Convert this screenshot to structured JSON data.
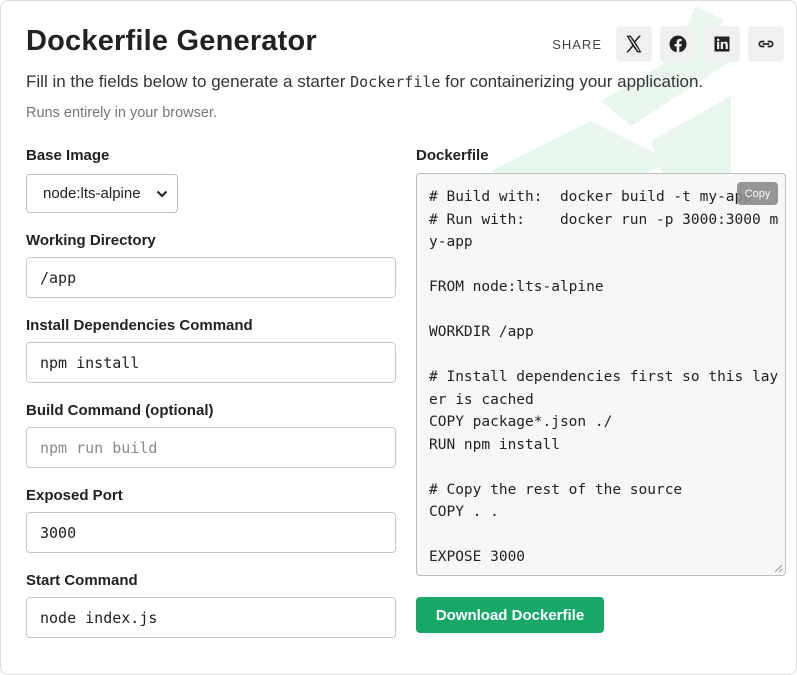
{
  "header": {
    "title": "Dockerfile Generator",
    "intro_before": "Fill in the fields below to generate a starter ",
    "intro_code": "Dockerfile",
    "intro_after": " for containerizing your application.",
    "subnote": "Runs entirely in your browser."
  },
  "share": {
    "label": "SHARE",
    "icons": [
      "x-icon",
      "facebook-icon",
      "linkedin-icon",
      "link-icon"
    ]
  },
  "form": {
    "base_image": {
      "label": "Base Image",
      "value": "node:lts-alpine"
    },
    "working_directory": {
      "label": "Working Directory",
      "value": "/app"
    },
    "install_command": {
      "label": "Install Dependencies Command",
      "value": "npm install"
    },
    "build_command": {
      "label": "Build Command (optional)",
      "value": "",
      "placeholder": "npm run build"
    },
    "exposed_port": {
      "label": "Exposed Port",
      "value": "3000"
    },
    "start_command": {
      "label": "Start Command",
      "value": "node index.js"
    }
  },
  "output": {
    "label": "Dockerfile",
    "copy_label": "Copy",
    "content": "# Build with:  docker build -t my-app .\n# Run with:    docker run -p 3000:3000 my-app\n\nFROM node:lts-alpine\n\nWORKDIR /app\n\n# Install dependencies first so this layer is cached\nCOPY package*.json ./\nRUN npm install\n\n# Copy the rest of the source\nCOPY . .\n\nEXPOSE 3000",
    "download_label": "Download Dockerfile"
  },
  "colors": {
    "accent": "#17a868",
    "watermark": "#e6f5ec"
  }
}
